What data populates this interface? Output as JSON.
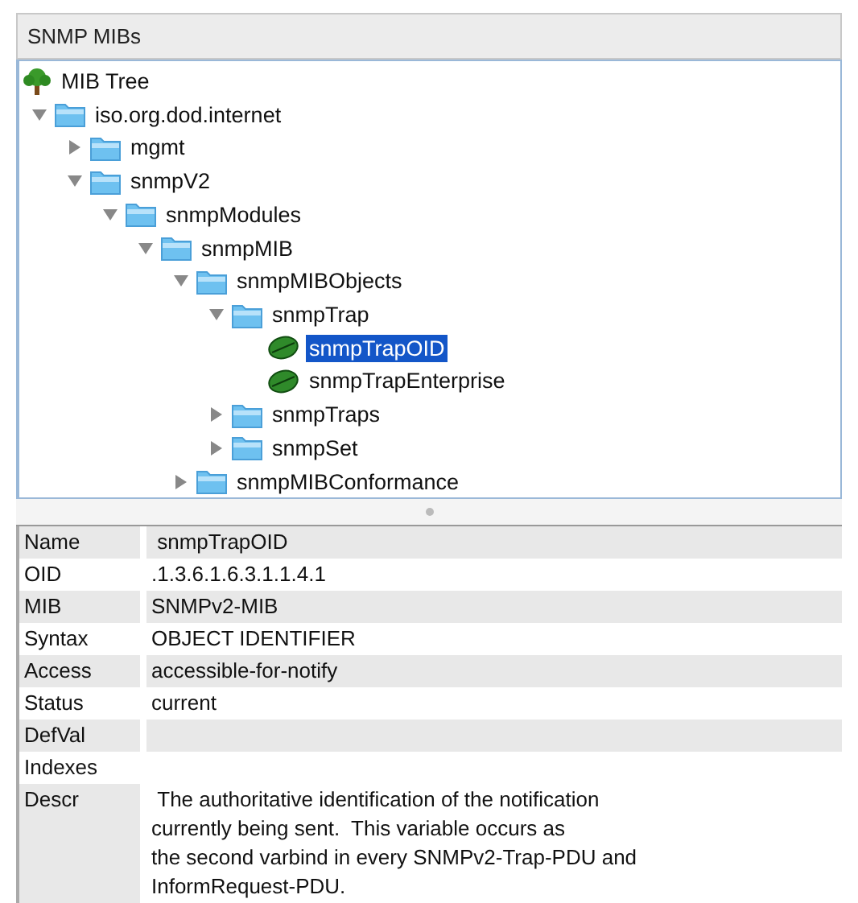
{
  "panel": {
    "title": "SNMP MIBs"
  },
  "tree": {
    "label": "MIB Tree",
    "kind": "root",
    "selected": false,
    "children": [
      {
        "label": "iso.org.dod.internet",
        "kind": "folder",
        "expanded": true,
        "selected": false,
        "children": [
          {
            "label": "mgmt",
            "kind": "folder",
            "expanded": false,
            "selected": false
          },
          {
            "label": "snmpV2",
            "kind": "folder",
            "expanded": true,
            "selected": false,
            "children": [
              {
                "label": "snmpModules",
                "kind": "folder",
                "expanded": true,
                "selected": false,
                "children": [
                  {
                    "label": "snmpMIB",
                    "kind": "folder",
                    "expanded": true,
                    "selected": false,
                    "children": [
                      {
                        "label": "snmpMIBObjects",
                        "kind": "folder",
                        "expanded": true,
                        "selected": false,
                        "children": [
                          {
                            "label": "snmpTrap",
                            "kind": "folder",
                            "expanded": true,
                            "selected": false,
                            "children": [
                              {
                                "label": "snmpTrapOID",
                                "kind": "leaf",
                                "selected": true
                              },
                              {
                                "label": "snmpTrapEnterprise",
                                "kind": "leaf",
                                "selected": false
                              }
                            ]
                          },
                          {
                            "label": "snmpTraps",
                            "kind": "folder",
                            "expanded": false,
                            "selected": false
                          },
                          {
                            "label": "snmpSet",
                            "kind": "folder",
                            "expanded": false,
                            "selected": false
                          }
                        ]
                      },
                      {
                        "label": "snmpMIBConformance",
                        "kind": "folder",
                        "expanded": false,
                        "selected": false
                      }
                    ]
                  }
                ]
              }
            ]
          }
        ]
      }
    ]
  },
  "properties": [
    {
      "name": "Name",
      "value": " snmpTrapOID"
    },
    {
      "name": "OID",
      "value": ".1.3.6.1.6.3.1.1.4.1"
    },
    {
      "name": "MIB",
      "value": "SNMPv2-MIB"
    },
    {
      "name": "Syntax",
      "value": "OBJECT IDENTIFIER"
    },
    {
      "name": "Access",
      "value": "accessible-for-notify"
    },
    {
      "name": "Status",
      "value": "current"
    },
    {
      "name": "DefVal"
    },
    {
      "name": "Indexes"
    },
    {
      "name": "Descr",
      "value": " The authoritative identification of the notification\ncurrently being sent.  This variable occurs as\nthe second varbind in every SNMPv2-Trap-PDU and\nInformRequest-PDU."
    }
  ]
}
